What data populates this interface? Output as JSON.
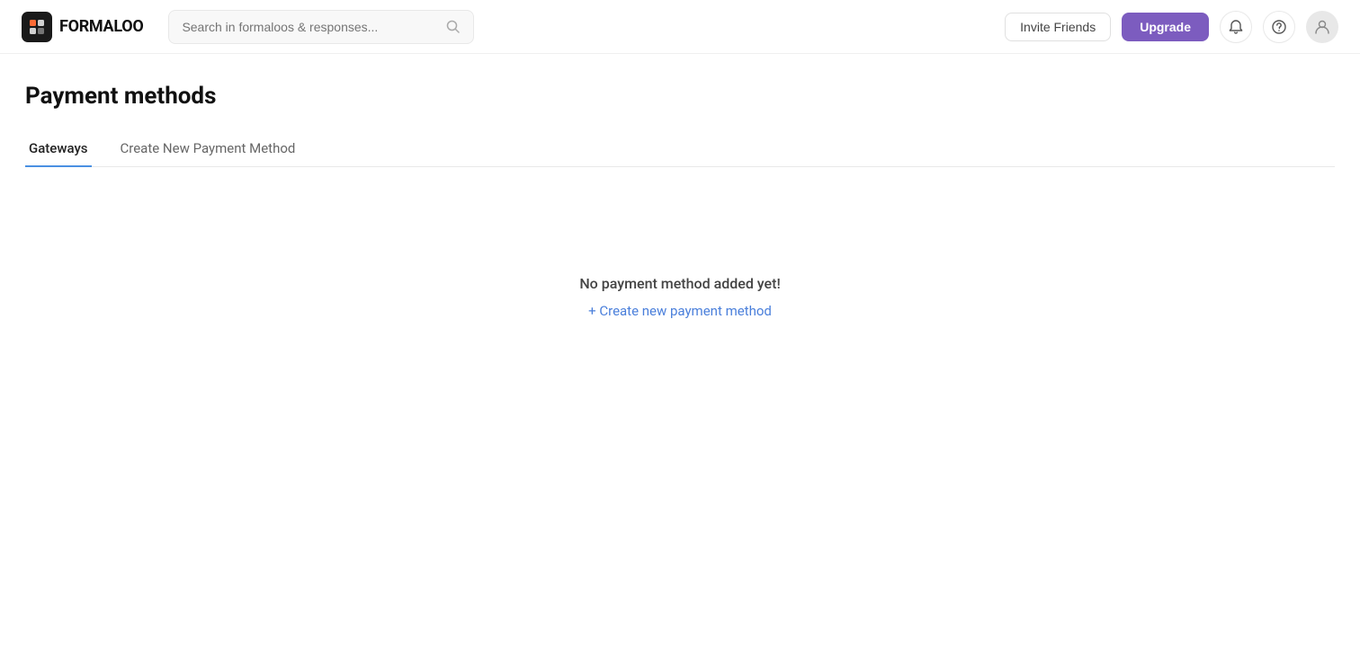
{
  "header": {
    "logo_text": "FORMALOO",
    "search_placeholder": "Search in formaloos & responses...",
    "invite_friends_label": "Invite Friends",
    "upgrade_label": "Upgrade"
  },
  "page": {
    "title": "Payment methods"
  },
  "tabs": [
    {
      "id": "gateways",
      "label": "Gateways",
      "active": true
    },
    {
      "id": "create",
      "label": "Create New Payment Method",
      "active": false
    }
  ],
  "empty_state": {
    "message": "No payment method added yet!",
    "create_link": "+ Create new payment method"
  }
}
